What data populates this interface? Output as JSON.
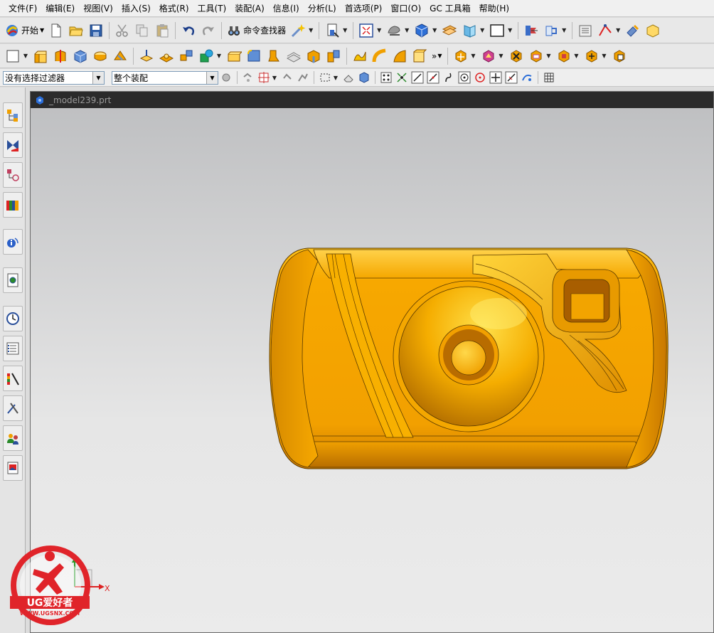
{
  "menu": [
    "文件(F)",
    "编辑(E)",
    "视图(V)",
    "插入(S)",
    "格式(R)",
    "工具(T)",
    "装配(A)",
    "信息(I)",
    "分析(L)",
    "首选项(P)",
    "窗口(O)",
    "GC 工具箱",
    "帮助(H)"
  ],
  "toolbar": {
    "start_label": "开始",
    "command_finder_label": "命令查找器",
    "overflow_glyph": "»"
  },
  "selection_bar": {
    "filter_value": "没有选择过滤器",
    "scope_value": "整个装配"
  },
  "graphics": {
    "title": "_model239.prt",
    "triad_x_label": "X"
  },
  "watermark": {
    "brand": "UG爱好者",
    "url": "WWW.UGSNX.COM"
  },
  "colors": {
    "model": "#f0a000",
    "model_highlight": "#ffd030",
    "model_shadow": "#b86a00",
    "watermark_red": "#e0242a"
  }
}
